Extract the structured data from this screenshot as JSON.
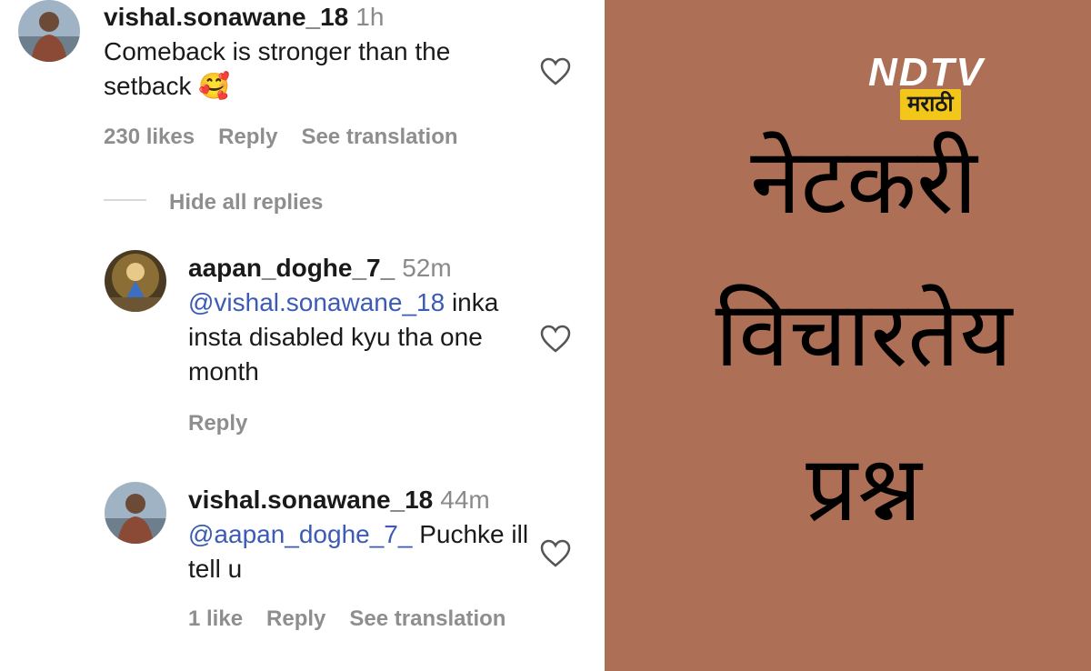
{
  "comments": [
    {
      "username": "vishal.sonawane_18",
      "time": "1h",
      "text": "Comeback is stronger than the setback",
      "emoji": "🥰",
      "likes": "230 likes",
      "reply": "Reply",
      "translation": "See translation"
    },
    {
      "username": "aapan_doghe_7_",
      "time": "52m",
      "mention": "@vishal.sonawane_18",
      "text": "inka insta disabled kyu tha one month",
      "reply": "Reply"
    },
    {
      "username": "vishal.sonawane_18",
      "time": "44m",
      "mention": "@aapan_doghe_7_",
      "text": "Puchke ill tell u",
      "likes": "1 like",
      "reply": "Reply",
      "translation": "See translation"
    }
  ],
  "hide_replies": "Hide all replies",
  "logo": {
    "brand": "NDTV",
    "sub": "मराठी"
  },
  "headline": {
    "line1": "नेटकरी",
    "line2": "विचारतेय",
    "line3": "प्रश्न"
  },
  "colors": {
    "panel_bg": "#ad6f55",
    "mention": "#3b5bb5",
    "meta": "#8e8e8e",
    "badge": "#f2c71a"
  },
  "icons": [
    "heart-outline-icon",
    "avatar-photo"
  ]
}
